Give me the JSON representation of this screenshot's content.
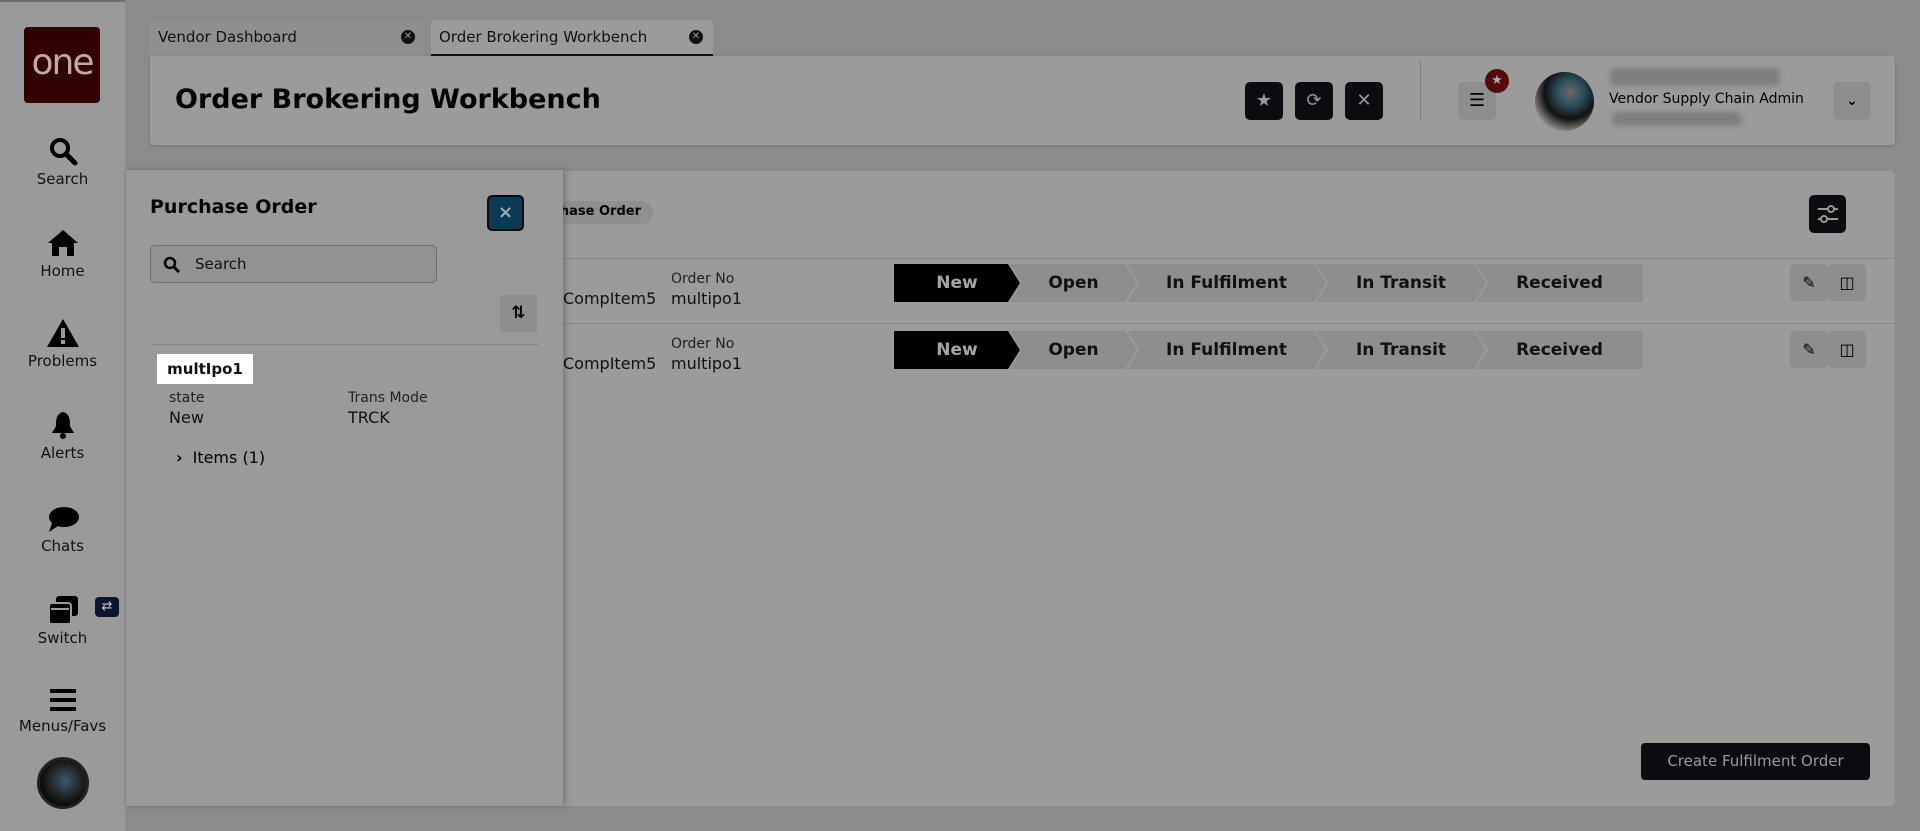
{
  "sidebar": {
    "logo": "one",
    "items": [
      {
        "label": "Search",
        "icon": "search-icon"
      },
      {
        "label": "Home",
        "icon": "home-icon"
      },
      {
        "label": "Problems",
        "icon": "warning-icon"
      },
      {
        "label": "Alerts",
        "icon": "bell-icon"
      },
      {
        "label": "Chats",
        "icon": "chat-icon"
      },
      {
        "label": "Switch",
        "icon": "switch-icon"
      },
      {
        "label": "Menus/Favs",
        "icon": "menu-icon"
      }
    ],
    "switch_badge": "⇄"
  },
  "tabs": [
    {
      "label": "Vendor Dashboard",
      "active": false
    },
    {
      "label": "Order Brokering Workbench",
      "active": true
    }
  ],
  "header": {
    "title": "Order Brokering Workbench",
    "user_role": "Vendor Supply Chain Admin"
  },
  "panel": {
    "title": "Purchase Order",
    "close": "×",
    "search_placeholder": "Search",
    "card": {
      "title": "multIpo1",
      "fields": [
        {
          "label": "state",
          "value": "New"
        },
        {
          "label": "Trans Mode",
          "value": "TRCK"
        }
      ],
      "items_label": "Items (1)"
    }
  },
  "main": {
    "chip": "hase Order",
    "rows": [
      {
        "item": "CompItem5",
        "order_label": "Order No",
        "order_no": "multipo1"
      },
      {
        "item": "CompItem5",
        "order_label": "Order No",
        "order_no": "multipo1"
      }
    ],
    "steps": [
      "New",
      "Open",
      "In Fulfilment",
      "In Transit",
      "Received"
    ],
    "current_step": "New",
    "create_button": "Create Fulfilment Order"
  }
}
